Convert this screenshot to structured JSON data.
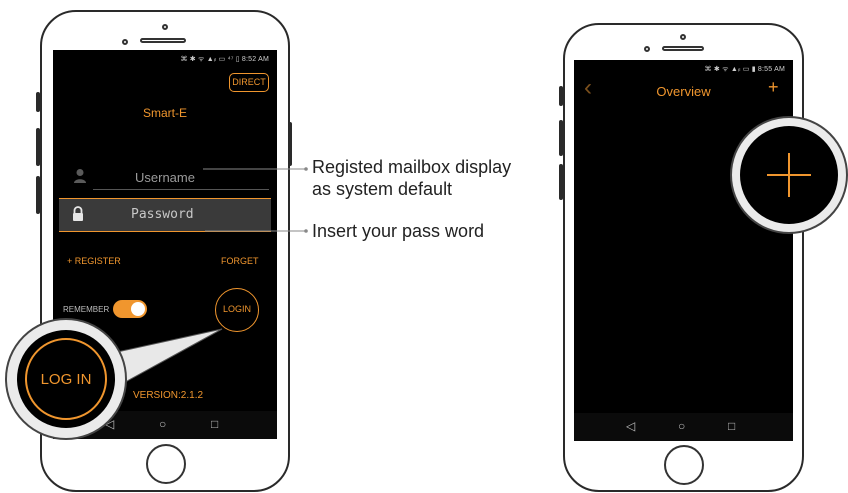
{
  "left_phone": {
    "status_bar": "⌘ ✱ ᯤ ▲ᵢₗ ▭ ⁴⁷ ▯ 8:52 AM",
    "direct_button": "DIRECT",
    "app_title": "Smart-E",
    "username_placeholder": "Username",
    "password_placeholder": "Password",
    "register_link": "+ REGISTER",
    "forget_link": "FORGET",
    "remember_label": "REMEMBER",
    "login_button": "LOGIN",
    "version": "VERSION:2.1.2",
    "zoom_login_label": "LOG IN",
    "nav": {
      "back": "◁",
      "home": "○",
      "recent": "□"
    }
  },
  "right_phone": {
    "status_bar": "⌘ ✱ ᯤ ▲ᵢₗ ▭ ▮ 8:55 AM",
    "title": "Overview",
    "back_icon": "‹",
    "add_icon": "+",
    "nav": {
      "back": "◁",
      "home": "○",
      "recent": "□"
    }
  },
  "callouts": {
    "username_line1": "Registed mailbox display",
    "username_line2": "as system default",
    "password": "Insert your pass word"
  },
  "colors": {
    "accent": "#f0962e",
    "screen": "#000000"
  }
}
